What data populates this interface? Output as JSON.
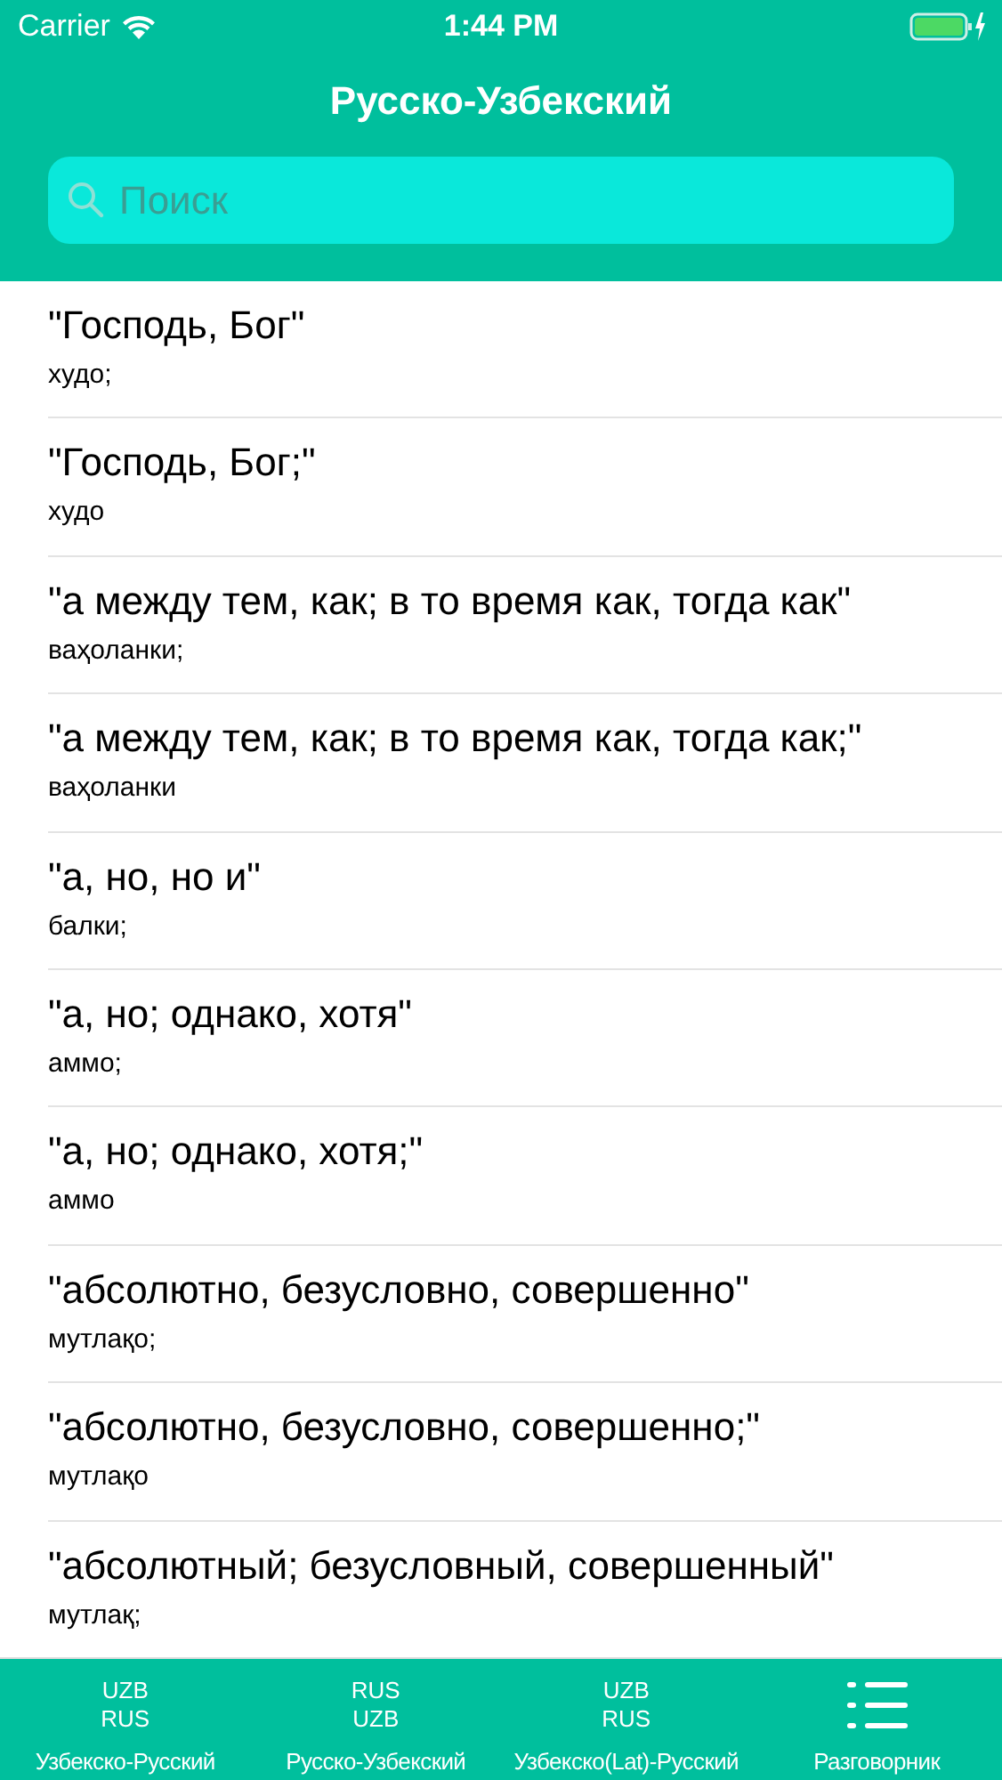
{
  "status_bar": {
    "carrier": "Carrier",
    "time": "1:44 PM"
  },
  "header": {
    "title": "Русско-Узбекский"
  },
  "search": {
    "placeholder": "Поиск"
  },
  "entries": [
    {
      "term": "\"Господь, Бог\"",
      "translation": "худо;"
    },
    {
      "term": "\"Господь, Бог;\"",
      "translation": "худо"
    },
    {
      "term": "\"а между тем, как; в то время как, тогда как\"",
      "translation": "ваҳоланки;"
    },
    {
      "term": "\"а между тем, как; в то время как, тогда как;\"",
      "translation": "ваҳоланки"
    },
    {
      "term": "\"а, но, но и\"",
      "translation": "балки;"
    },
    {
      "term": "\"а, но; однако, хотя\"",
      "translation": "аммо;"
    },
    {
      "term": "\"а, но; однако, хотя;\"",
      "translation": "аммо"
    },
    {
      "term": "\"абсолютно, безусловно, совершенно\"",
      "translation": "мутлақо;"
    },
    {
      "term": "\"абсолютно, безусловно, совершенно;\"",
      "translation": "мутлақо"
    },
    {
      "term": "\"абсолютный; безусловный, совершенный\"",
      "translation": "мутлақ;"
    }
  ],
  "tab_bar": [
    {
      "kind": "codes",
      "codes": [
        "UZB",
        "RUS"
      ],
      "label": "Узбекско-Русский"
    },
    {
      "kind": "codes",
      "codes": [
        "RUS",
        "UZB"
      ],
      "label": "Русско-Узбекский"
    },
    {
      "kind": "codes",
      "codes": [
        "UZB",
        "RUS"
      ],
      "label": "Узбекско(Lat)-Русский"
    },
    {
      "kind": "list",
      "label": "Разговорник"
    }
  ]
}
